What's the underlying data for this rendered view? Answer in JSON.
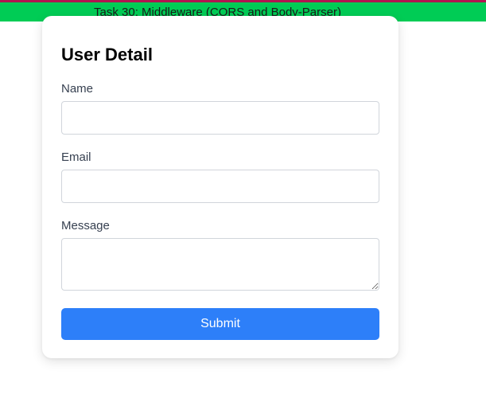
{
  "header": {
    "title": "Task 30: Middleware (CORS and Body-Parser)"
  },
  "form": {
    "title": "User Detail",
    "fields": {
      "name": {
        "label": "Name",
        "value": ""
      },
      "email": {
        "label": "Email",
        "value": ""
      },
      "message": {
        "label": "Message",
        "value": ""
      }
    },
    "submit_label": "Submit"
  },
  "colors": {
    "header_bg": "#00cc55",
    "accent_top": "#b0154f",
    "button_bg": "#2d7ff9"
  }
}
